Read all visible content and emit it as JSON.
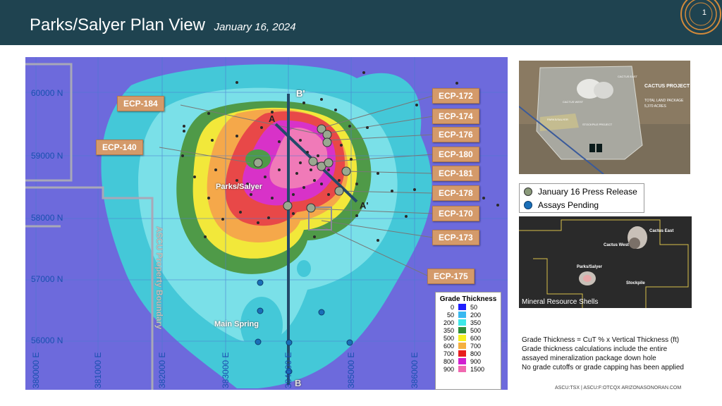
{
  "header": {
    "title": "Parks/Salyer Plan View",
    "date": "January 16, 2024",
    "page_number": "1"
  },
  "map": {
    "callouts_right": [
      "ECP-172",
      "ECP-174",
      "ECP-176",
      "ECP-180",
      "ECP-181",
      "ECP-178",
      "ECP-170",
      "ECP-173",
      "ECP-175"
    ],
    "callouts_left": [
      "ECP-184",
      "ECP-140"
    ],
    "northings": [
      "60000 N",
      "59000 N",
      "58000 N",
      "57000 N",
      "56000 N"
    ],
    "eastings": [
      "380000 E",
      "381000 E",
      "382000 E",
      "383000 E",
      "384000 E",
      "385000 E",
      "386000 E"
    ],
    "section_labels": {
      "a": "A",
      "a_prime": "A'",
      "b": "B",
      "b_prime": "B'"
    },
    "area_labels": {
      "parks_salyer": "Parks/Salyer",
      "main_spring": "Main Spring"
    },
    "boundary_label": "ASCU Property Boundary"
  },
  "grade_legend": {
    "title": "Grade Thickness",
    "rows": [
      {
        "lo": "0",
        "hi": "50",
        "color": "#1e1eff"
      },
      {
        "lo": "50",
        "hi": "200",
        "color": "#38b8f0"
      },
      {
        "lo": "200",
        "hi": "350",
        "color": "#3ee8e8"
      },
      {
        "lo": "350",
        "hi": "500",
        "color": "#2f8f3a"
      },
      {
        "lo": "500",
        "hi": "600",
        "color": "#f5f020"
      },
      {
        "lo": "600",
        "hi": "700",
        "color": "#f5b040"
      },
      {
        "lo": "700",
        "hi": "800",
        "color": "#e81e1e"
      },
      {
        "lo": "800",
        "hi": "900",
        "color": "#d020d0"
      },
      {
        "lo": "900",
        "hi": "1500",
        "color": "#f068b0"
      }
    ]
  },
  "inset1": {
    "title": "CACTUS PROJECT",
    "subtitle": "TOTAL LAND PACKAGE",
    "acres": "5,370 ACRES",
    "labels": [
      "CACTUS WEST",
      "CACTUS EAST",
      "PARKS/SALYER",
      "STOCKPILE PROJECT"
    ]
  },
  "press_legend": {
    "items": [
      {
        "label": "January 16 Press Release",
        "color": "#8a9a7a"
      },
      {
        "label": "Assays Pending",
        "color": "#1a6fb8"
      }
    ]
  },
  "inset2": {
    "labels": {
      "cactus_east": "Cactus East",
      "cactus_west": "Cactus West",
      "parks_salyer": "Parks/Salyer",
      "stockpile": "Stockpile"
    },
    "caption": "Mineral Resource Shells"
  },
  "notes": [
    "Grade Thickness = CuT % x Vertical Thickness (ft)",
    "Grade thickness calculations include the entire",
    "assayed mineralization package down hole",
    "No grade cutoffs or grade capping has been applied"
  ],
  "footer": "ASCU:TSX | ASCU:F:OTCQX  ARIZONASONORAN.COM"
}
